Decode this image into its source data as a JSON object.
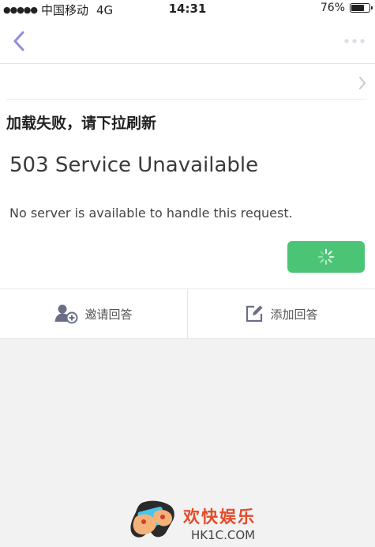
{
  "status_bar": {
    "carrier": "中国移动",
    "network": "4G",
    "time": "14:31",
    "battery": "76%",
    "battery_level": 0.76
  },
  "nav": {
    "back_icon": "chevron-left-icon",
    "more_icon": "more-dots-icon",
    "accent_color": "#8e8ed9"
  },
  "content": {
    "error_title": "加载失败，请下拉刷新",
    "error_heading": "503 Service Unavailable",
    "error_message": "No server is available to handle this request.",
    "refresh_button_color": "#4cc476",
    "refresh_icon": "spinner-icon"
  },
  "actions": {
    "invite": {
      "label": "邀请回答",
      "icon": "add-user-icon"
    },
    "add_answer": {
      "label": "添加回答",
      "icon": "edit-icon"
    }
  },
  "watermark": {
    "text": "欢快娱乐",
    "url": "HK1C.COM"
  }
}
